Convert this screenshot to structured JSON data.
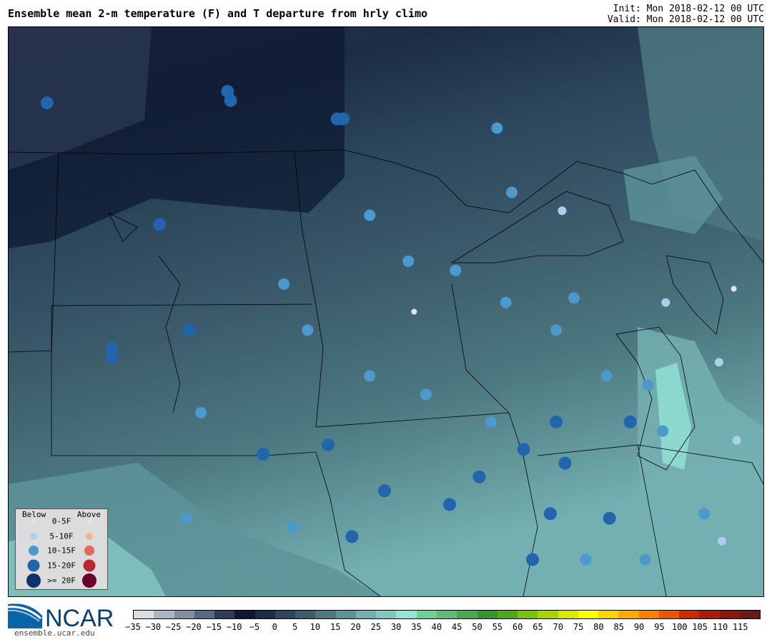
{
  "header": {
    "title": "Ensemble mean 2-m temperature (F) and T departure from hrly climo",
    "init": "Init: Mon 2018-02-12 00 UTC",
    "valid": "Valid: Mon 2018-02-12 00 UTC"
  },
  "logo": {
    "text": "NCAR",
    "url": "ensemble.ucar.edu"
  },
  "legend": {
    "below_label": "Below",
    "above_label": "Above",
    "rows": [
      {
        "label": "0-5F",
        "below_color": "#dde6ee",
        "above_color": "#f1e3dc"
      },
      {
        "label": "5-10F",
        "below_color": "#a9d2ea",
        "above_color": "#f5b291"
      },
      {
        "label": "10-15F",
        "below_color": "#4c99cd",
        "above_color": "#df6c56"
      },
      {
        "label": "15-20F",
        "below_color": "#2166ac",
        "above_color": "#b8272c"
      },
      {
        "label": ">= 20F",
        "below_color": "#0d3268",
        "above_color": "#6b0028"
      }
    ]
  },
  "colorbar": {
    "tick_labels": [
      "−35",
      "−30",
      "−25",
      "−20",
      "−15",
      "−10",
      "−5",
      "0",
      "5",
      "10",
      "15",
      "20",
      "25",
      "30",
      "35",
      "40",
      "45",
      "50",
      "55",
      "60",
      "65",
      "70",
      "75",
      "80",
      "85",
      "90",
      "95",
      "100",
      "105",
      "110",
      "115"
    ],
    "colors": [
      "#dadfe4",
      "#aeb5c2",
      "#838ea1",
      "#5a6782",
      "#2f3b5c",
      "#0d1930",
      "#1c2c46",
      "#2c465c",
      "#3c5c6c",
      "#4c7880",
      "#5d9499",
      "#74b0b1",
      "#82c6c0",
      "#93e4d4",
      "#6fcf98",
      "#5ebd74",
      "#4aa94f",
      "#37952c",
      "#4ea81c",
      "#79c00f",
      "#a8d400",
      "#d8ea00",
      "#ffff00",
      "#ffd400",
      "#ffaa00",
      "#ff7f00",
      "#ee5500",
      "#cc2a00",
      "#a81c0c",
      "#8a1508",
      "#6a1a10"
    ]
  },
  "stations": [
    {
      "lon": -103.2,
      "lat": 48.95,
      "color": "#2166ac"
    },
    {
      "lon": -97.1,
      "lat": 49.2,
      "color": "#2166ac"
    },
    {
      "lon": -97.0,
      "lat": 49.0,
      "color": "#2166ac"
    },
    {
      "lon": -93.4,
      "lat": 48.6,
      "color": "#2166ac"
    },
    {
      "lon": -93.2,
      "lat": 48.6,
      "color": "#2166ac"
    },
    {
      "lon": -88.0,
      "lat": 48.4,
      "color": "#4c99cd"
    },
    {
      "lon": -87.5,
      "lat": 47.0,
      "color": "#4c99cd"
    },
    {
      "lon": -85.8,
      "lat": 46.6,
      "color": "#a9d2ea"
    },
    {
      "lon": -92.3,
      "lat": 46.5,
      "color": "#4c99cd"
    },
    {
      "lon": -99.4,
      "lat": 46.3,
      "color": "#2166ac"
    },
    {
      "lon": -91.0,
      "lat": 45.5,
      "color": "#4c99cd"
    },
    {
      "lon": -89.4,
      "lat": 45.3,
      "color": "#4c99cd"
    },
    {
      "lon": -95.2,
      "lat": 45.0,
      "color": "#4c99cd"
    },
    {
      "lon": -87.7,
      "lat": 44.6,
      "color": "#4c99cd"
    },
    {
      "lon": -85.4,
      "lat": 44.7,
      "color": "#4c99cd"
    },
    {
      "lon": -90.8,
      "lat": 44.4,
      "color": "#dde6ee"
    },
    {
      "lon": -82.3,
      "lat": 44.6,
      "color": "#a9d2ea"
    },
    {
      "lon": -80.0,
      "lat": 44.9,
      "color": "#dde6ee"
    },
    {
      "lon": -98.4,
      "lat": 44.0,
      "color": "#2166ac"
    },
    {
      "lon": -94.4,
      "lat": 44.0,
      "color": "#4c99cd"
    },
    {
      "lon": -86.0,
      "lat": 44.0,
      "color": "#4c99cd"
    },
    {
      "lon": -101.0,
      "lat": 43.6,
      "color": "#2166ac"
    },
    {
      "lon": -101.0,
      "lat": 43.4,
      "color": "#2166ac"
    },
    {
      "lon": -92.3,
      "lat": 43.0,
      "color": "#4c99cd"
    },
    {
      "lon": -84.3,
      "lat": 43.0,
      "color": "#4c99cd"
    },
    {
      "lon": -82.9,
      "lat": 42.8,
      "color": "#4c99cd"
    },
    {
      "lon": -80.5,
      "lat": 43.3,
      "color": "#a9d2ea"
    },
    {
      "lon": -90.4,
      "lat": 42.6,
      "color": "#4c99cd"
    },
    {
      "lon": -98.0,
      "lat": 42.2,
      "color": "#4c99cd"
    },
    {
      "lon": -88.2,
      "lat": 42.0,
      "color": "#4c99cd"
    },
    {
      "lon": -86.0,
      "lat": 42.0,
      "color": "#2166ac"
    },
    {
      "lon": -83.5,
      "lat": 42.0,
      "color": "#2166ac"
    },
    {
      "lon": -82.4,
      "lat": 41.8,
      "color": "#4c99cd"
    },
    {
      "lon": -79.9,
      "lat": 41.6,
      "color": "#a9d2ea"
    },
    {
      "lon": -93.7,
      "lat": 41.5,
      "color": "#2166ac"
    },
    {
      "lon": -87.1,
      "lat": 41.4,
      "color": "#2166ac"
    },
    {
      "lon": -85.7,
      "lat": 41.1,
      "color": "#2166ac"
    },
    {
      "lon": -95.9,
      "lat": 41.3,
      "color": "#2166ac"
    },
    {
      "lon": -88.6,
      "lat": 40.8,
      "color": "#2166ac"
    },
    {
      "lon": -91.8,
      "lat": 40.5,
      "color": "#2166ac"
    },
    {
      "lon": -89.6,
      "lat": 40.2,
      "color": "#2166ac"
    },
    {
      "lon": -86.2,
      "lat": 40.0,
      "color": "#2166ac"
    },
    {
      "lon": -84.2,
      "lat": 39.9,
      "color": "#2166ac"
    },
    {
      "lon": -81.0,
      "lat": 40.0,
      "color": "#4c99cd"
    },
    {
      "lon": -98.5,
      "lat": 39.9,
      "color": "#4c99cd"
    },
    {
      "lon": -94.9,
      "lat": 39.7,
      "color": "#4c99cd"
    },
    {
      "lon": -92.9,
      "lat": 39.5,
      "color": "#2166ac"
    },
    {
      "lon": -86.8,
      "lat": 39.0,
      "color": "#2166ac"
    },
    {
      "lon": -85.0,
      "lat": 39.0,
      "color": "#4c99cd"
    },
    {
      "lon": -83.0,
      "lat": 39.0,
      "color": "#4c99cd"
    },
    {
      "lon": -80.4,
      "lat": 39.4,
      "color": "#a9d2ea"
    }
  ],
  "places": []
}
